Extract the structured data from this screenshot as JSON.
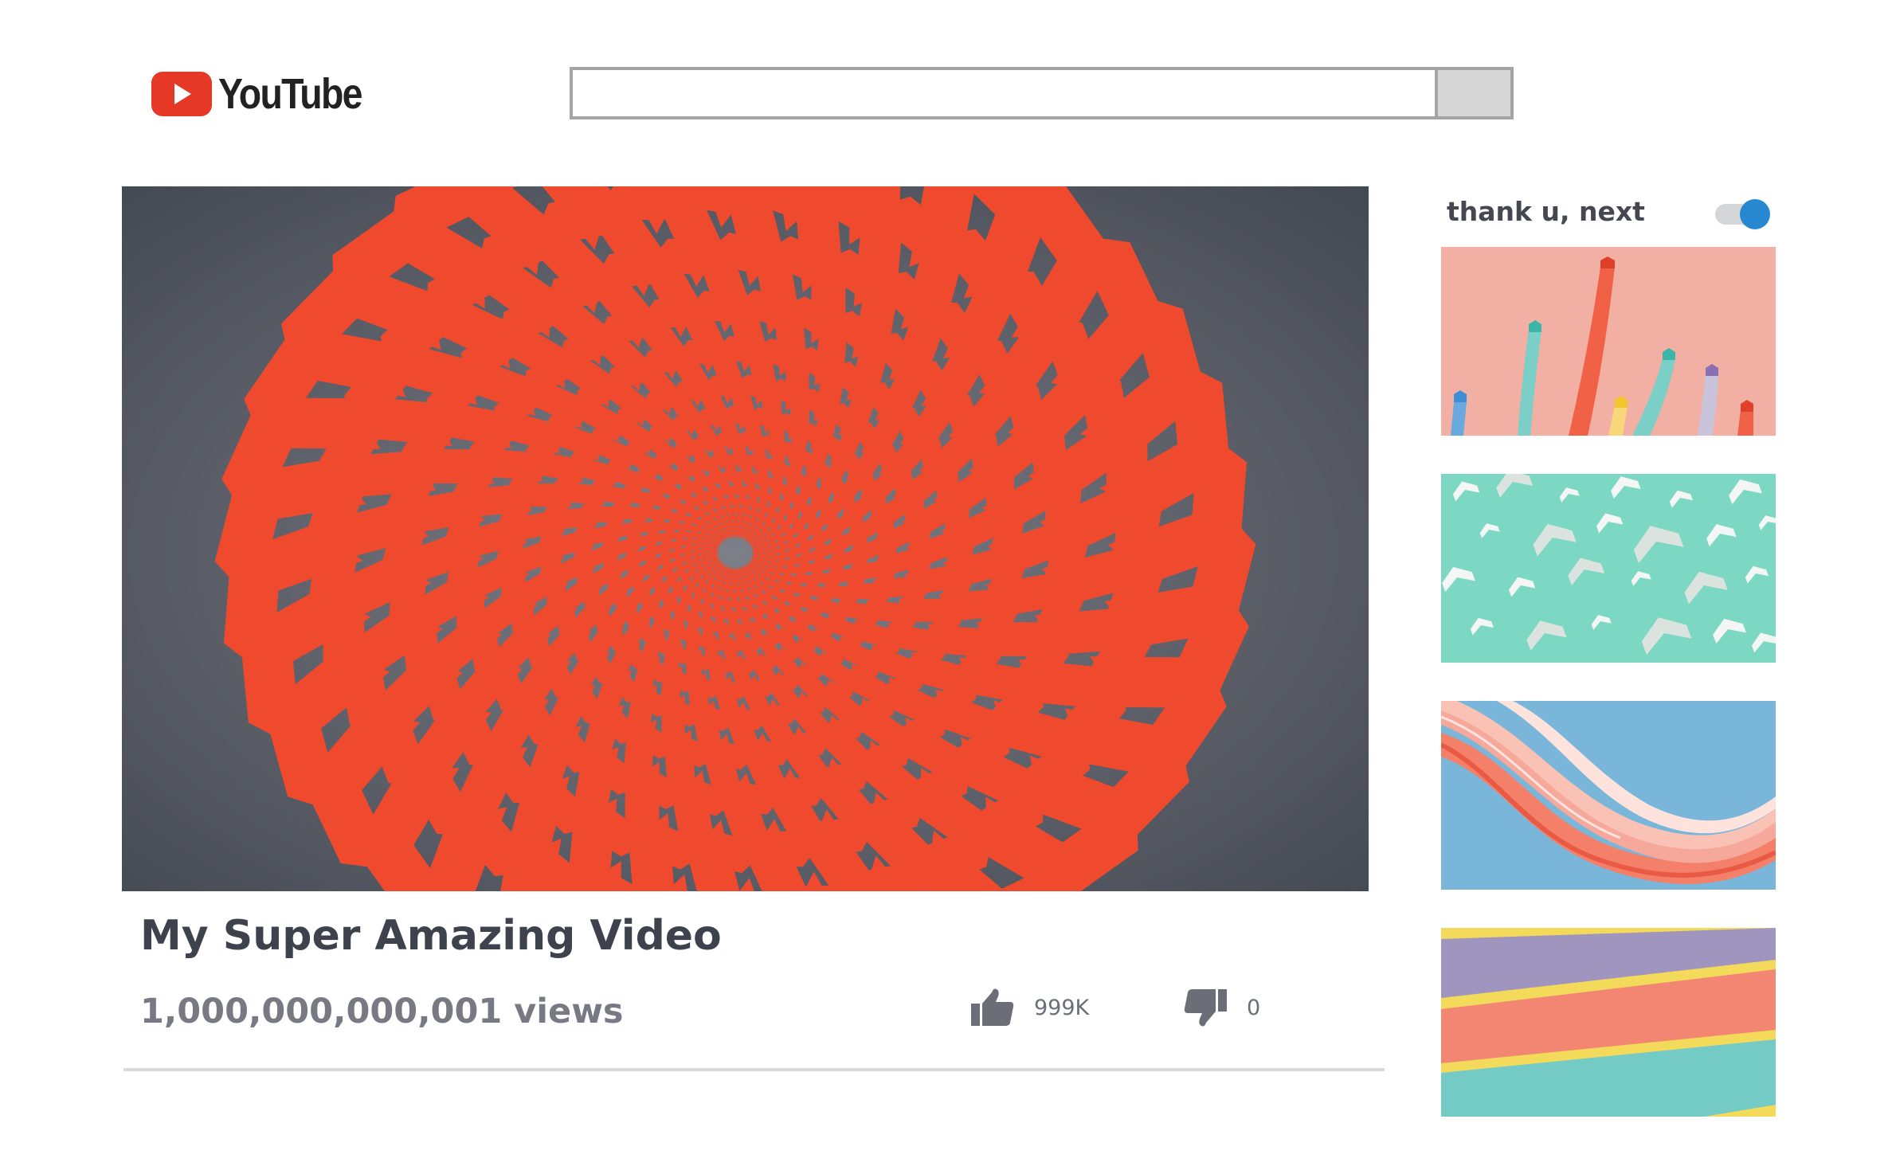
{
  "header": {
    "logo_text": "YouTube",
    "search": {
      "value": "",
      "placeholder": ""
    }
  },
  "video": {
    "title": "My Super Amazing Video",
    "views": "1,000,000,000,001 views",
    "likes": "999K",
    "dislikes": "0"
  },
  "sidebar": {
    "up_next_label": "thank u, next",
    "autoplay_on": true
  },
  "colors": {
    "brand_red": "#e53827",
    "chevron_red": "#f04a2e",
    "toggle_blue": "#2788d1",
    "player_bg": "#62656e"
  },
  "icons": {
    "play": "play-icon",
    "like": "thumbs-up-icon",
    "dislike": "thumbs-down-icon"
  }
}
